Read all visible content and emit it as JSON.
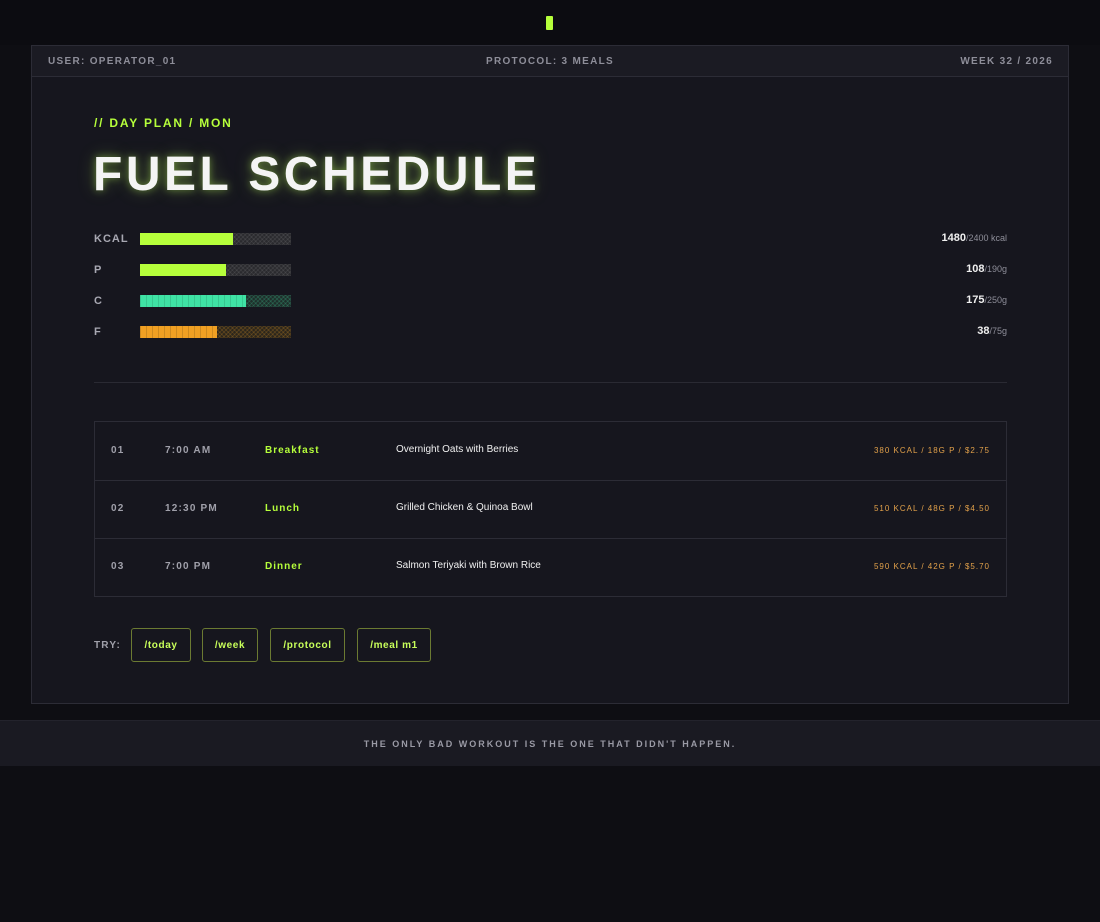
{
  "header": {
    "user": "USER: OPERATOR_01",
    "protocol": "PROTOCOL: 3 MEALS",
    "week": "WEEK 32 / 2026"
  },
  "hero": {
    "eyebrow": "// DAY PLAN / MON",
    "title": "FUEL SCHEDULE"
  },
  "macros": [
    {
      "label": "KCAL",
      "value": "1480",
      "goal": "/2400 kcal",
      "current": 1480,
      "target": 2400,
      "color": "#b6ff3b"
    },
    {
      "label": "P",
      "value": "108",
      "goal": "/190g",
      "current": 108,
      "target": 190,
      "color": "#b6ff3b"
    },
    {
      "label": "C",
      "value": "175",
      "goal": "/250g",
      "current": 175,
      "target": 250,
      "color": "#3fe3a5"
    },
    {
      "label": "F",
      "value": "38",
      "goal": "/75g",
      "current": 38,
      "target": 75,
      "color": "#f0a023"
    }
  ],
  "meals": [
    {
      "num": "01",
      "time": "7:00 AM",
      "type": "Breakfast",
      "dish": "Overnight Oats with Berries",
      "stats": "380 KCAL / 18G P / $2.75"
    },
    {
      "num": "02",
      "time": "12:30 PM",
      "type": "Lunch",
      "dish": "Grilled Chicken & Quinoa Bowl",
      "stats": "510 KCAL / 48G P / $4.50"
    },
    {
      "num": "03",
      "time": "7:00 PM",
      "type": "Dinner",
      "dish": "Salmon Teriyaki with Brown Rice",
      "stats": "590 KCAL / 42G P / $5.70"
    }
  ],
  "try": {
    "label": "TRY:",
    "commands": [
      "/today",
      "/week",
      "/protocol",
      "/meal m1"
    ]
  },
  "footer": {
    "quote": "THE ONLY BAD WORKOUT IS THE ONE THAT DIDN'T HAPPEN."
  },
  "colors": {
    "accent": "#b6ff3b",
    "carbs": "#3fe3a5",
    "fat": "#f0a023",
    "stats": "#e2a14a"
  }
}
